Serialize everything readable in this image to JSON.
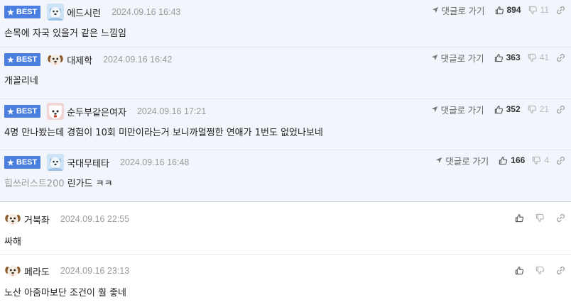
{
  "labels": {
    "best": "BEST",
    "reply": "댓글로 가기"
  },
  "colors": {
    "best_badge": "#4a7fe0",
    "best_background": "#f2f5fb"
  },
  "comments": [
    {
      "best": true,
      "nick": "에드시런",
      "avatar": "blue-dog-icon",
      "date": "2024.09.16 16:43",
      "text": "손목에 자국 있을거 같은 느낌임",
      "likes": "894",
      "dislikes": "11"
    },
    {
      "best": true,
      "nick": "대제학",
      "avatar": "puppy-icon",
      "date": "2024.09.16 16:42",
      "text": "개꼴리네",
      "likes": "363",
      "dislikes": "41"
    },
    {
      "best": true,
      "nick": "순두부같은여자",
      "avatar": "white-dog-icon",
      "date": "2024.09.16 17:21",
      "text": "4명 만나봤는데 경험이 10회 미만이라는거 보니까멀쩡한 연애가 1번도 없었나보네",
      "likes": "352",
      "dislikes": "21"
    },
    {
      "best": true,
      "nick": "국대무테타",
      "avatar": "blue-dog-icon",
      "date": "2024.09.16 16:48",
      "tag": "힙쓰러스트200",
      "text": "린가드 ㅋㅋ",
      "likes": "166",
      "dislikes": "4"
    },
    {
      "best": false,
      "nick": "거북좌",
      "avatar": "puppy-icon",
      "date": "2024.09.16 22:55",
      "text": "싸해"
    },
    {
      "best": false,
      "nick": "페라도",
      "avatar": "puppy-icon",
      "date": "2024.09.16 23:13",
      "text": "노산 아줌마보단 조건이 훨 좋네"
    }
  ]
}
